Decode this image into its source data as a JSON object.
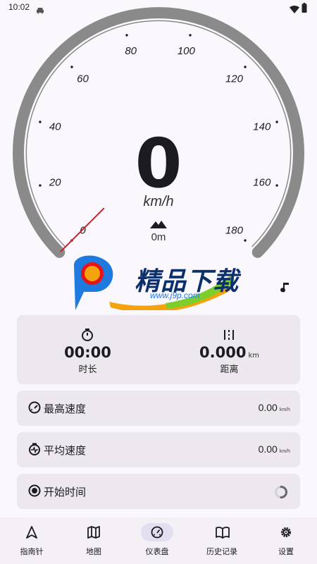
{
  "status_bar": {
    "time": "10:02",
    "icons": [
      "car-icon",
      "wifi-icon",
      "battery-icon"
    ]
  },
  "speedometer": {
    "speed": "0",
    "unit": "km/h",
    "altitude": "0m",
    "scale_labels": [
      "0",
      "20",
      "40",
      "60",
      "80",
      "100",
      "120",
      "140",
      "160",
      "180"
    ],
    "scale_min": 0,
    "scale_max": 180,
    "current_speed_value": 0,
    "needle_color": "#e8121b"
  },
  "watermark": {
    "title": "精品下载",
    "url": "www.j9p.com"
  },
  "trip": {
    "duration": {
      "value": "00:00",
      "label": "时长"
    },
    "distance": {
      "value": "0.000",
      "unit": "km",
      "label": "距离"
    }
  },
  "rows": {
    "max_speed": {
      "label": "最高速度",
      "value": "0.00",
      "unit": "km/h"
    },
    "avg_speed": {
      "label": "平均速度",
      "value": "0.00",
      "unit": "km/h"
    },
    "start_time": {
      "label": "开始时间"
    }
  },
  "nav": {
    "items": [
      {
        "label": "指南针",
        "icon": "compass-arrow-icon"
      },
      {
        "label": "地图",
        "icon": "map-icon"
      },
      {
        "label": "仪表盘",
        "icon": "dashboard-icon",
        "active": true
      },
      {
        "label": "历史记录",
        "icon": "book-icon"
      },
      {
        "label": "设置",
        "icon": "gear-icon"
      }
    ]
  },
  "colors": {
    "accent_pill": "#e3dff0",
    "gauge_arc": "#8a8a8a",
    "card": "#ece8ee",
    "background": "#fbf8fd"
  }
}
